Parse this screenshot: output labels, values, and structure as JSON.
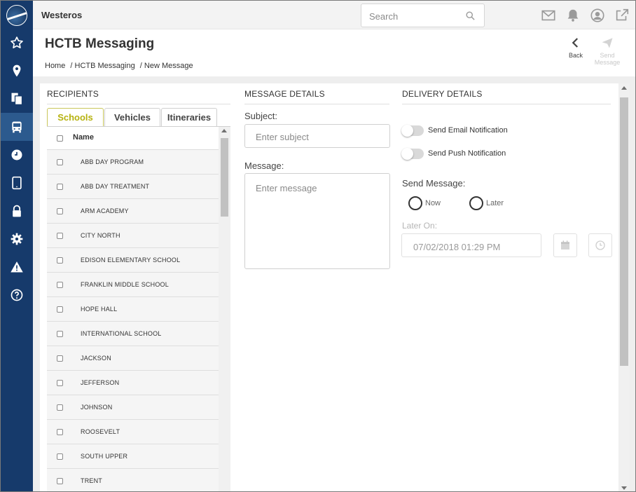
{
  "app": {
    "name": "Westeros"
  },
  "search": {
    "placeholder": "Search"
  },
  "header": {
    "title": "HCTB Messaging",
    "breadcrumb": [
      "Home",
      "/ HCTB Messaging",
      "/ New Message"
    ],
    "back_label": "Back",
    "send_label": "Send Message"
  },
  "recipients": {
    "title": "RECIPIENTS",
    "tabs": [
      {
        "label": "Schools",
        "active": true
      },
      {
        "label": "Vehicles",
        "active": false
      },
      {
        "label": "Itineraries",
        "active": false
      }
    ],
    "column_name": "Name",
    "rows": [
      "ABB  DAY PROGRAM",
      "ABB  DAY TREATMENT",
      "ARM  ACADEMY",
      "CITY NORTH",
      "EDISON  ELEMENTARY SCHOOL",
      "FRANKLIN MIDDLE SCHOOL",
      "HOPE HALL",
      "INTERNATIONAL SCHOOL",
      "JACKSON",
      "JEFFERSON",
      "JOHNSON",
      "ROOSEVELT",
      "SOUTH UPPER",
      "TRENT"
    ]
  },
  "message": {
    "title": "MESSAGE DETAILS",
    "subject_label": "Subject:",
    "subject_placeholder": "Enter subject",
    "message_label": "Message:",
    "message_placeholder": "Enter message"
  },
  "delivery": {
    "title": "DELIVERY DETAILS",
    "email_label": "Send Email Notification",
    "push_label": "Send Push Notification",
    "send_message_label": "Send Message:",
    "now_label": "Now",
    "later_label": "Later",
    "later_on_label": "Later On:",
    "later_on_value": "07/02/2018 01:29 PM"
  },
  "colors": {
    "sidebar": "#163a6b",
    "active_tab": "#b6b20f"
  }
}
